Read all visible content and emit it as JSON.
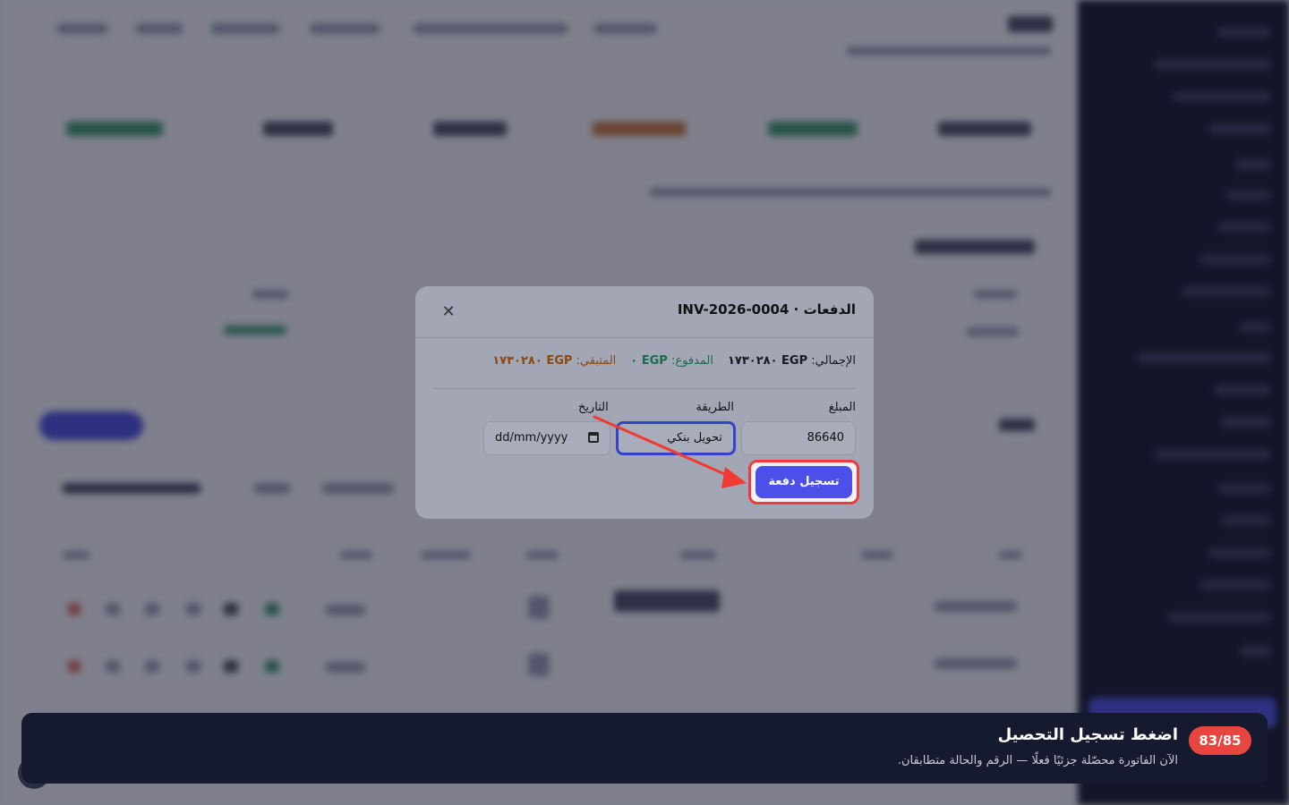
{
  "modal": {
    "title": "الدفعات · INV-2026-0004",
    "close_icon": "close-icon",
    "summary": {
      "total_label": "الإجمالي:",
      "total_value": "EGP ١٧٣٠٢٨٠",
      "paid_label": "المدفوع:",
      "paid_value": "EGP ٠",
      "remaining_label": "المتبقي:",
      "remaining_value": "EGP ١٧٣٠٢٨٠"
    },
    "fields": {
      "amount_label": "المبلغ",
      "amount_value": "86640",
      "method_label": "الطريقة",
      "method_value": "تحويل بنكي",
      "date_label": "التاريخ",
      "date_placeholder": "dd/mm/yyyy"
    },
    "submit_label": "تسجيل دفعة"
  },
  "tutorial": {
    "step": "83/85",
    "title": "اضغط تسجيل التحصيل",
    "body": "الآن الفاتورة محصّلة جزئيًا فعلًا — الرقم والحالة متطابقان."
  },
  "colors": {
    "accent": "#4c4fe8",
    "highlight": "#ef3b3b",
    "paid": "#1d6b4d",
    "remaining": "#8a4a12",
    "badge": "#e6463f"
  }
}
